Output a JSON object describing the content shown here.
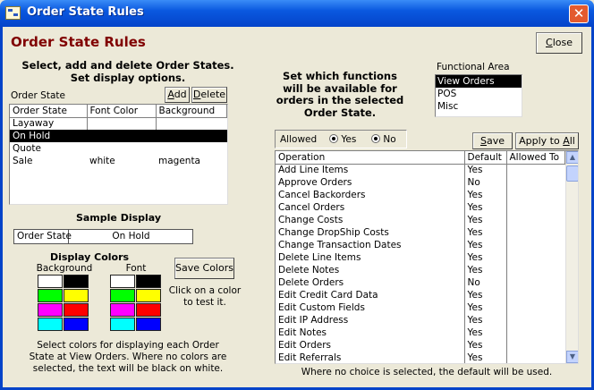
{
  "window": {
    "title": "Order State Rules",
    "close_glyph": "✕"
  },
  "heading": "Order State Rules",
  "close_button": {
    "label_pre": "",
    "label_u": "C",
    "label_post": "lose"
  },
  "left": {
    "instructions_line1": "Select, add and delete Order States.",
    "instructions_line2": "Set display options.",
    "list_label": "Order State",
    "add_button": {
      "label_pre": "",
      "label_u": "A",
      "label_post": "dd"
    },
    "delete_button": {
      "label_pre": "",
      "label_u": "D",
      "label_post": "elete"
    },
    "columns": [
      "Order State",
      "Font Color",
      "Background"
    ],
    "rows": [
      {
        "state": "Layaway",
        "font": "",
        "bg": ""
      },
      {
        "state": "On Hold",
        "font": "",
        "bg": ""
      },
      {
        "state": "Quote",
        "font": "",
        "bg": ""
      },
      {
        "state": "Sale",
        "font": "white",
        "bg": "magenta"
      }
    ],
    "selected_row": 1,
    "sample_title": "Sample Display",
    "sample_label": "Order State",
    "sample_value": "On Hold",
    "colors_title": "Display Colors",
    "background_label": "Background",
    "font_label": "Font",
    "save_colors_label": "Save Colors",
    "click_hint_line1": "Click on a color",
    "click_hint_line2": "to test it.",
    "palette": [
      "#ffffff",
      "#000000",
      "#00ff00",
      "#ffff00",
      "#ff00ff",
      "#ff0000",
      "#00ffff",
      "#0000ff"
    ],
    "help_line1": "Select colors for displaying each Order",
    "help_line2": "State at View Orders. Where no colors are",
    "help_line3": "selected, the text will be black on white."
  },
  "right": {
    "instructions_line1": "Set which functions",
    "instructions_line2": "will be available for",
    "instructions_line3": "orders in the selected",
    "instructions_line4": "Order State.",
    "functional_area_label": "Functional Area",
    "functional_areas": [
      "View Orders",
      "POS",
      "Misc"
    ],
    "selected_area": 0,
    "allowed_label": "Allowed",
    "yes_label": "Yes",
    "no_label": "No",
    "save_button": {
      "label_pre": "",
      "label_u": "S",
      "label_post": "ave"
    },
    "apply_all_button": {
      "label_pre": "Apply to ",
      "label_u": "A",
      "label_post": "ll"
    },
    "columns": [
      "Operation",
      "Default",
      "Allowed To"
    ],
    "operations": [
      {
        "op": "Add Line Items",
        "def": "Yes",
        "allowed": ""
      },
      {
        "op": "Approve Orders",
        "def": "No",
        "allowed": ""
      },
      {
        "op": "Cancel Backorders",
        "def": "Yes",
        "allowed": ""
      },
      {
        "op": "Cancel Orders",
        "def": "Yes",
        "allowed": ""
      },
      {
        "op": "Change Costs",
        "def": "Yes",
        "allowed": ""
      },
      {
        "op": "Change DropShip Costs",
        "def": "Yes",
        "allowed": ""
      },
      {
        "op": "Change Transaction Dates",
        "def": "Yes",
        "allowed": ""
      },
      {
        "op": "Delete Line Items",
        "def": "Yes",
        "allowed": ""
      },
      {
        "op": "Delete Notes",
        "def": "Yes",
        "allowed": ""
      },
      {
        "op": "Delete Orders",
        "def": "No",
        "allowed": ""
      },
      {
        "op": "Edit Credit Card Data",
        "def": "Yes",
        "allowed": ""
      },
      {
        "op": "Edit Custom Fields",
        "def": "Yes",
        "allowed": ""
      },
      {
        "op": "Edit IP Address",
        "def": "Yes",
        "allowed": ""
      },
      {
        "op": "Edit Notes",
        "def": "Yes",
        "allowed": ""
      },
      {
        "op": "Edit Orders",
        "def": "Yes",
        "allowed": ""
      },
      {
        "op": "Edit Referrals",
        "def": "Yes",
        "allowed": ""
      }
    ],
    "footer": "Where no choice is selected, the default will be used."
  },
  "colors": {
    "heading": "#800000",
    "titlebar": "#0a58df"
  }
}
